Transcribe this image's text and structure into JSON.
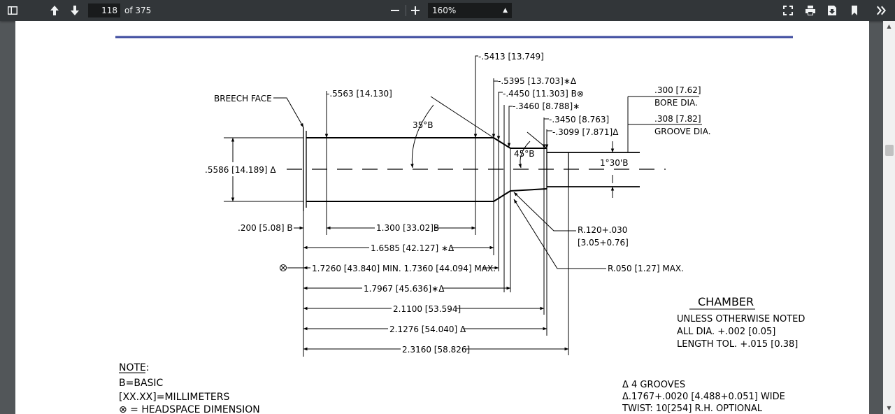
{
  "toolbar": {
    "current_page": "118",
    "total_pages": "of 375",
    "zoom": "160%"
  },
  "drawing": {
    "lengths": {
      "l5413": "-.5413 [13.749]",
      "l5563": "-.5563 [14.130]",
      "l5395": "-.5395 [13.703]∗Δ",
      "l4450": "-.4450 [11.303] B⊗",
      "l3460": "-.3460 [8.788]∗",
      "l3450": "-.3450 [8.763]",
      "l3099": "-.3099 [7.871]Δ",
      "breech": "BREECH FACE",
      "ang35": "35°B",
      "ang45": "45°B",
      "ang130": "1°30'B",
      "bore_val": ".300 [7.62]",
      "bore_lbl": "BORE DIA.",
      "groove_val": ".308 [7.82]",
      "groove_lbl": "GROOVE DIA.",
      "d5586": ".5586 [14.189] Δ",
      "d200": ".200 [5.08] B",
      "d1300": "1.300 [33.02]B",
      "d16585": "1.6585 [42.127] ∗Δ",
      "d17260": "1.7260 [43.840] MIN. 1.7360 [44.094] MAX.",
      "d17967": "1.7967 [45.636]∗Δ",
      "d21100": "2.1100 [53.594]",
      "d21276": "2.1276 [54.040] Δ",
      "d23160": "2.3160 [58.826]",
      "r120a": "R.120+.030",
      "r120b": "[3.05+0.76]",
      "r050": "R.050 [1.27] MAX.",
      "chamber": "CHAMBER",
      "tol1": "UNLESS OTHERWISE NOTED",
      "tol2": "ALL DIA. +.002 [0.05]",
      "tol3": "LENGTH TOL. +.015 [0.38]",
      "note_title": "NOTE:",
      "note1": "B=BASIC",
      "note2": "[XX.XX]=MILLIMETERS",
      "note3": "⊗ = HEADSPACE DIMENSION",
      "grooves1": "Δ 4 GROOVES",
      "grooves2": "Δ.1767+.0020 [4.488+0.051] WIDE",
      "grooves3": "TWIST: 10[254] R.H. OPTIONAL"
    }
  }
}
